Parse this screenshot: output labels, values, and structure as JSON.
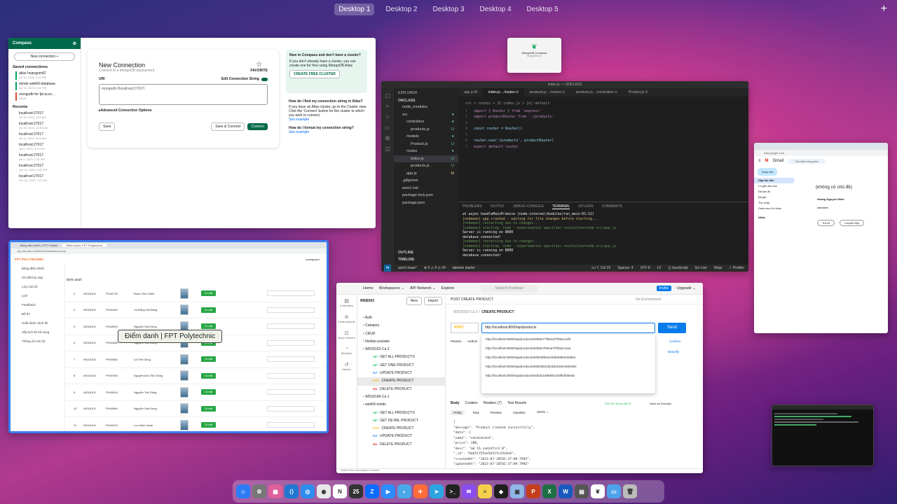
{
  "mission_control": {
    "desktops": [
      "Desktop 1",
      "Desktop 2",
      "Desktop 3",
      "Desktop 4",
      "Desktop 5"
    ],
    "active_index": 0,
    "add_symbol": "+"
  },
  "compass": {
    "window_title": "MongoDB Compass",
    "app_name": "Compass",
    "new_connection_btn": "New connection +",
    "saved_heading": "Saved connections",
    "saved": [
      {
        "name": "atlas hoangnm42",
        "date": "Jul 16, 2023, 4:21 PM",
        "color": "g"
      },
      {
        "name": "minds-web69-database",
        "date": "Jul 15, 2023, 3:41 PM",
        "color": "g"
      },
      {
        "name": "mongodb for fpt acco...",
        "date": "Never",
        "color": "r"
      }
    ],
    "recents_heading": "Recents",
    "recents": [
      {
        "name": "localhost:27017",
        "date": "Jul 18, 2023, 1:53 AM"
      },
      {
        "name": "localhost:27017",
        "date": "Jul 16, 2023, 10:55 AM"
      },
      {
        "name": "localhost:27017",
        "date": "Jul 14, 2023, 8:24 AM"
      },
      {
        "name": "localhost:27017",
        "date": "Jul 8, 2023, 3:12 PM"
      },
      {
        "name": "localhost:27017",
        "date": "Jul 6, 2023, 7:15 PM"
      },
      {
        "name": "localhost:27017",
        "date": "Jun 30, 2023, 9:31 PM"
      },
      {
        "name": "localhost:27017",
        "date": "Jun 18, 2023, 7:07 AM"
      }
    ],
    "card_title": "New Connection",
    "card_subtitle": "Connect to a MongoDB deployment",
    "favorite": "FAVORITE",
    "uri_label": "URI",
    "edit_toggle": "Edit Connection String",
    "uri_value": "mongodb://localhost:27017/",
    "advanced": "Advanced Connection Options",
    "save": "Save",
    "save_connect": "Save & Connect",
    "connect": "Connect",
    "help_title": "New to Compass and don't have a cluster?",
    "help_text": "If you don't already have a cluster, you can create one for free using MongoDB Atlas",
    "help_btn": "CREATE FREE CLUSTER",
    "help2_title": "How do I find my connection string in Atlas?",
    "help2_text": "If you have an Atlas cluster, go to the Cluster view. Click the 'Connect' button for the cluster to which you wish to connect.",
    "help2_link": "See example",
    "help3_title": "How do I format my connection string?",
    "help3_link": "See example"
  },
  "mongo_mini": {
    "title": "MongoDB Compass",
    "sub": "MongoDB Inc"
  },
  "vscode": {
    "title": "index.js — ONCLASS",
    "explorer": "EXPLORER",
    "root": "ONCLASS",
    "tree": [
      {
        "name": "node_modules",
        "depth": 1,
        "badge": ""
      },
      {
        "name": "src",
        "depth": 1,
        "badge": "●"
      },
      {
        "name": "controllers",
        "depth": 2,
        "badge": "●"
      },
      {
        "name": "products.js",
        "depth": 3,
        "badge": "U"
      },
      {
        "name": "models",
        "depth": 2,
        "badge": "●"
      },
      {
        "name": "Product.js",
        "depth": 3,
        "badge": "U"
      },
      {
        "name": "routes",
        "depth": 2,
        "badge": "●"
      },
      {
        "name": "index.js",
        "depth": 3,
        "badge": "U"
      },
      {
        "name": "products.js",
        "depth": 3,
        "badge": "U"
      },
      {
        "name": "app.js",
        "depth": 2,
        "badge": "M"
      },
      {
        "name": ".gitignore",
        "depth": 1,
        "badge": ""
      },
      {
        "name": "asm1.md",
        "depth": 1,
        "badge": ""
      },
      {
        "name": "package-lock.json",
        "depth": 1,
        "badge": ""
      },
      {
        "name": "package.json",
        "depth": 1,
        "badge": ""
      }
    ],
    "outline": "OUTLINE",
    "timeline": "TIMELINE",
    "tabs": [
      "app.js M",
      "index.js .../routes U",
      "products.js .../routes U",
      "products.js .../controllers U",
      "Product.js U"
    ],
    "breadcrumb": "src > routes > JS index.js > [e] default",
    "code": [
      "import { Router } from 'express'",
      "import productRouter from './products'",
      "",
      "const router = Router()",
      "",
      "router.use('/products', productRouter)",
      "export default router"
    ],
    "terminal_tabs": [
      "PROBLEMS",
      "OUTPUT",
      "DEBUG CONSOLE",
      "TERMINAL",
      "GITLENS",
      "COMMENTS"
    ],
    "terminal_lines": [
      {
        "t": "    at async handleMainPromise (node:internal/modules/run_main:61:12)",
        "c": "white"
      },
      {
        "t": "[nodemon] app crashed - waiting for file changes before starting...",
        "c": "yel"
      },
      {
        "t": "[nodemon] restarting due to changes...",
        "c": "grn"
      },
      {
        "t": "[nodemon] starting `node --experimental-specifier-resolution=node src/app.js`",
        "c": "grn"
      },
      {
        "t": "Server is running on 8000",
        "c": "white"
      },
      {
        "t": "database connected!",
        "c": "white"
      },
      {
        "t": "[nodemon] restarting due to changes...",
        "c": "grn"
      },
      {
        "t": "[nodemon] starting `node --experimental-specifier-resolution=node src/app.js`",
        "c": "grn"
      },
      {
        "t": "Server is running on 8000",
        "c": "white"
      },
      {
        "t": "database connected!",
        "c": "white"
      }
    ],
    "status": {
      "remote": "⇆",
      "branch": "asm1-base*",
      "sync": "⊗ 0 ⚠ 0  ⊙ 24",
      "tabnine": "tabnine starter",
      "pos": "Ln 7, Col 22",
      "spaces": "Spaces: 4",
      "enc": "UTF-8",
      "eol": "LF",
      "lang": "{} JavaScript",
      "golive": "Go Live",
      "ninja": "Ninja",
      "prettier": "✓ Prettier"
    }
  },
  "gmail": {
    "app": "Gmail",
    "search": "Tìm kiếm trong thư",
    "compose": "Soạn thư",
    "nav": [
      "Hộp thư đến",
      "Có gắn dấu sao",
      "Đã tạm ẩn",
      "Đã gửi",
      "Thư nháp",
      "Danh mục thư khác"
    ],
    "labels": "Nhãn",
    "subject": "(không có chủ đề)",
    "sender": "Hoang Nguyen Minh",
    "body": "dsfsdsfsr",
    "reply": "Trả lời",
    "forward": "Chuyển tiếp"
  },
  "fpt": {
    "tab1": "Bảng điều khiển | FPT Polytec",
    "tab2": "Điểm danh | FPT Polytechnic",
    "url": "ap.poly.edu.vn/teacher/attendance.php",
    "logo": "FPT POLYTECHNIC",
    "user": "hoanguyen",
    "nav": [
      "Bảng điều khiển",
      "Chi tiết lớp dạy",
      "Lớp của tôi",
      "Lịch",
      "Feedback",
      "Đề thi",
      "Xuất danh sách thi",
      "Xếp lịch thi bổ sung",
      "Thông số cán bộ"
    ],
    "col": "Điểm danh",
    "rows": [
      {
        "n": "3",
        "cls": "WD18102",
        "id": "PH40778",
        "name": "Đoàn Văn Chiến"
      },
      {
        "n": "4",
        "cls": "WD18102",
        "id": "PH40349",
        "name": "Vũ Đăng Hải Đăng"
      },
      {
        "n": "5",
        "cls": "WD18102",
        "id": "PH40833",
        "name": "Nguyễn Văn Đông"
      },
      {
        "n": "6",
        "cls": "WD18102",
        "id": "PH40488",
        "name": "Nguyễn Văn Dũng"
      },
      {
        "n": "7",
        "cls": "WD18102",
        "id": "PH40666",
        "name": "Lã Tiến Dũng"
      },
      {
        "n": "8",
        "cls": "WD18102",
        "id": "PH39765",
        "name": "Nguyễn Anh Tiến Dũng"
      },
      {
        "n": "9",
        "cls": "WD18102",
        "id": "PH40618",
        "name": "Nguyễn Thế Dũng"
      },
      {
        "n": "10",
        "cls": "WD18102",
        "id": "PH40666",
        "name": "Nguyễn Văn Dung"
      },
      {
        "n": "11",
        "cls": "WD18102",
        "id": "PH40403",
        "name": "Lưu Bình Hanh"
      }
    ],
    "present": "Có mặt",
    "tooltip": "Điểm danh | FPT Polytechnic"
  },
  "postman": {
    "nav": [
      "Home",
      "Workspaces ⌄",
      "API Network ⌄",
      "Explore"
    ],
    "search": "Search Postman",
    "invite": "Invite",
    "upgrade": "Upgrade ⌄",
    "workspace": "WEB503",
    "new": "New",
    "import": "Import",
    "tab": "POST CREATE PRODUCT",
    "env": "No Environment",
    "breadcrumb_pre": "WD18102-Ca 2  /",
    "breadcrumb": "CREATE PRODUCT",
    "side": [
      "Collections",
      "Environments",
      "Mock Servers",
      "Monitors",
      "History"
    ],
    "tree": [
      {
        "label": "Auth",
        "method": "",
        "indent": 0
      },
      {
        "label": "Category",
        "method": "",
        "indent": 0
      },
      {
        "label": "CRUD",
        "method": "",
        "indent": 0
      },
      {
        "label": "Nodejs-youtube",
        "method": "",
        "indent": 0
      },
      {
        "label": "WD18102-Ca 2",
        "method": "",
        "indent": 0
      },
      {
        "label": "GET ALL PRODUCTS",
        "method": "GET",
        "indent": 1
      },
      {
        "label": "GET ONE PRODUCT",
        "method": "GET",
        "indent": 1
      },
      {
        "label": "UPDATE PRODUCT",
        "method": "PUT",
        "indent": 1
      },
      {
        "label": "CREATE PRODUCT",
        "method": "POST",
        "indent": 1
      },
      {
        "label": "DELETE PRODUCT",
        "method": "DEL",
        "indent": 1
      },
      {
        "label": "WD18106-Ca 1",
        "method": "",
        "indent": 0
      },
      {
        "label": "web69-mindx",
        "method": "",
        "indent": 0
      },
      {
        "label": "GET ALL PRODUCTS",
        "method": "GET",
        "indent": 1
      },
      {
        "label": "GET DETAIL PRODUCT",
        "method": "GET",
        "indent": 1
      },
      {
        "label": "CREATE PRODUCT",
        "method": "POST",
        "indent": 1
      },
      {
        "label": "UPDATE PRODUCT",
        "method": "PUT",
        "indent": 1
      },
      {
        "label": "DELETE PRODUCT",
        "method": "DEL",
        "indent": 1
      }
    ],
    "method": "POST",
    "url": "http://localhost:8000/api/products",
    "send": "Send",
    "suggestions": [
      "http://localhost:8000/api/products/64b5e77f5eacf7f2bac11f0",
      "http://localhost:8000/api/products/64b5e7b5eacf7f2bac11ee",
      "http://localhost:8000/api/products/64b29bba3c8dfa0884e28d81",
      "http://localhost:8000/api/products/64b29b3cbb3dc526e1928460",
      "http://localhost:8000/api/products/64b3a1596b8ccb0f93f3beab"
    ],
    "params": "Params",
    "auth": "Authori",
    "cookies": "Cookies",
    "beautify": "Beautify",
    "resp_tabs": [
      "Body",
      "Cookies",
      "Headers (7)",
      "Test Results"
    ],
    "resp_meta": "200 OK  46 ms  482 B",
    "save_example": "Save as Example",
    "resp_views": [
      "Pretty",
      "Raw",
      "Preview",
      "Visualize",
      "JSON ⌄"
    ],
    "json": [
      "{",
      "  \"message\": \"Product created successfully\",",
      "  \"data\": {",
      "    \"name\": \"sdsdsdsdsd\",",
      "    \"price\": 200,",
      "    \"desc\": \"mô tả sadzdfzz1 B\",",
      "    \"_id\": \"64b51f55ae5b52fc191de6\",",
      "    \"createdAt\": \"2023-07-18T02:37:09.799Z\",",
      "    \"updatedAt\": \"2023-07-18T02:37:09.799Z\""
    ],
    "status": "Online   Find and replace   Console"
  },
  "dock": [
    {
      "name": "finder-icon",
      "c": "#2d7cf6",
      "g": "☺"
    },
    {
      "name": "settings-icon",
      "c": "#777",
      "g": "⚙"
    },
    {
      "name": "launchpad-icon",
      "c": "#e05f9c",
      "g": "▦"
    },
    {
      "name": "vscode-icon",
      "c": "#1f77d0",
      "g": "⟨⟩"
    },
    {
      "name": "safari-icon",
      "c": "#2e8ef0",
      "g": "◎"
    },
    {
      "name": "chrome-icon",
      "c": "#e8e8e8",
      "g": "◉"
    },
    {
      "name": "notion-icon",
      "c": "#fff",
      "g": "N"
    },
    {
      "name": "calendar-icon",
      "c": "#333",
      "g": "25"
    },
    {
      "name": "zalo-icon",
      "c": "#0a6bff",
      "g": "Z"
    },
    {
      "name": "zoom-icon",
      "c": "#2d8cff",
      "g": "▶"
    },
    {
      "name": "qq-icon",
      "c": "#4aa8e8",
      "g": "◐"
    },
    {
      "name": "postman-icon",
      "c": "#ff6c37",
      "g": "✈"
    },
    {
      "name": "telegram-icon",
      "c": "#2ba5e1",
      "g": "➤"
    },
    {
      "name": "terminal-icon",
      "c": "#222",
      "g": ">_"
    },
    {
      "name": "messenger-icon",
      "c": "#8a4df0",
      "g": "✉"
    },
    {
      "name": "notes-icon",
      "c": "#f6d04d",
      "g": "≡"
    },
    {
      "name": "figma-icon",
      "c": "#1e1e1e",
      "g": "◆"
    },
    {
      "name": "preview-icon",
      "c": "#8fb7e6",
      "g": "▣"
    },
    {
      "name": "powerpoint-icon",
      "c": "#c43e1c",
      "g": "P"
    },
    {
      "name": "excel-icon",
      "c": "#1d7044",
      "g": "X"
    },
    {
      "name": "word-icon",
      "c": "#185abd",
      "g": "W"
    },
    {
      "name": "capture-icon",
      "c": "#555",
      "g": "▤"
    },
    {
      "name": "mongodb-icon",
      "c": "#fff",
      "g": "❦"
    },
    {
      "name": "folder-icon",
      "c": "#4fa3ea",
      "g": "▭"
    },
    {
      "name": "trash-icon",
      "c": "#bbb",
      "g": "🗑"
    }
  ]
}
